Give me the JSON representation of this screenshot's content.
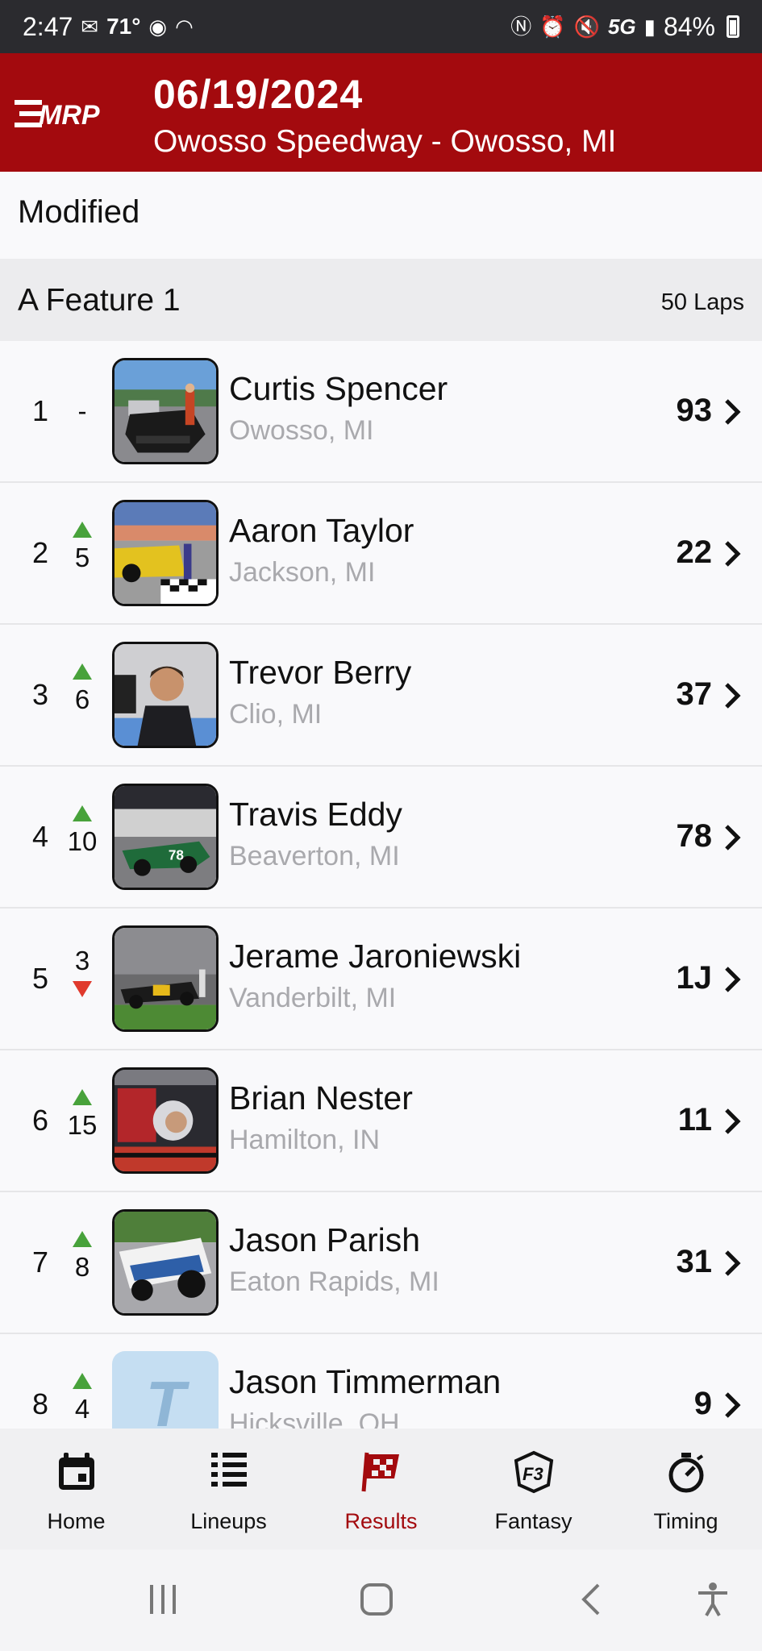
{
  "status_bar": {
    "time": "2:47",
    "temperature": "71°",
    "network": "5G",
    "battery": "84%"
  },
  "header": {
    "logo_text": "MRP",
    "date": "06/19/2024",
    "venue": "Owosso Speedway - Owosso, MI"
  },
  "race": {
    "class_name": "Modified",
    "feature_name": "A Feature 1",
    "laps": "50 Laps"
  },
  "results": [
    {
      "pos": "1",
      "change": "-",
      "direction": "none",
      "name": "Curtis Spencer",
      "hometown": "Owosso, MI",
      "car": "93"
    },
    {
      "pos": "2",
      "change": "5",
      "direction": "up",
      "name": "Aaron Taylor",
      "hometown": "Jackson, MI",
      "car": "22"
    },
    {
      "pos": "3",
      "change": "6",
      "direction": "up",
      "name": "Trevor Berry",
      "hometown": "Clio, MI",
      "car": "37"
    },
    {
      "pos": "4",
      "change": "10",
      "direction": "up",
      "name": "Travis Eddy",
      "hometown": "Beaverton, MI",
      "car": "78"
    },
    {
      "pos": "5",
      "change": "3",
      "direction": "down",
      "name": "Jerame Jaroniewski",
      "hometown": "Vanderbilt, MI",
      "car": "1J"
    },
    {
      "pos": "6",
      "change": "15",
      "direction": "up",
      "name": "Brian Nester",
      "hometown": "Hamilton, IN",
      "car": "11"
    },
    {
      "pos": "7",
      "change": "8",
      "direction": "up",
      "name": "Jason Parish",
      "hometown": "Eaton Rapids, MI",
      "car": "31"
    },
    {
      "pos": "8",
      "change": "4",
      "direction": "up",
      "name": "Jason Timmerman",
      "hometown": "Hicksville, OH",
      "car": "9",
      "avatar_letter": "T"
    }
  ],
  "tabs": [
    {
      "label": "Home",
      "icon": "calendar-icon"
    },
    {
      "label": "Lineups",
      "icon": "list-icon"
    },
    {
      "label": "Results",
      "icon": "checkered-flag-icon",
      "active": true
    },
    {
      "label": "Fantasy",
      "icon": "fantasy-f3-icon"
    },
    {
      "label": "Timing",
      "icon": "stopwatch-icon"
    }
  ],
  "colors": {
    "brand_red": "#a30a0e",
    "up_green": "#48a23b",
    "down_red": "#e03a2d"
  }
}
